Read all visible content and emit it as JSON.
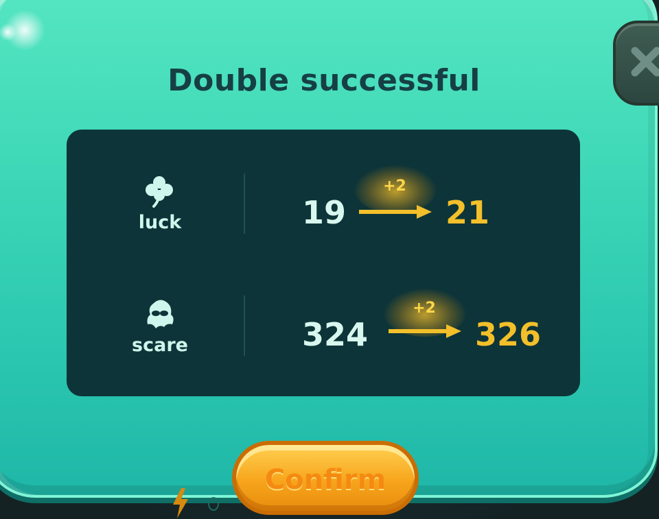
{
  "dialog": {
    "title": "Double successful",
    "confirm_label": "Confirm"
  },
  "stats": [
    {
      "name": "luck",
      "icon": "clover-icon",
      "old_value": "19",
      "bonus": "+2",
      "new_value": "21"
    },
    {
      "name": "scare",
      "icon": "ghost-icon",
      "old_value": "324",
      "bonus": "+2",
      "new_value": "326"
    }
  ],
  "colors": {
    "panel": "#3fd9b8",
    "card": "#0d3438",
    "new_value": "#f3bf2a",
    "confirm": "#f7a51c",
    "title": "#163f45"
  }
}
